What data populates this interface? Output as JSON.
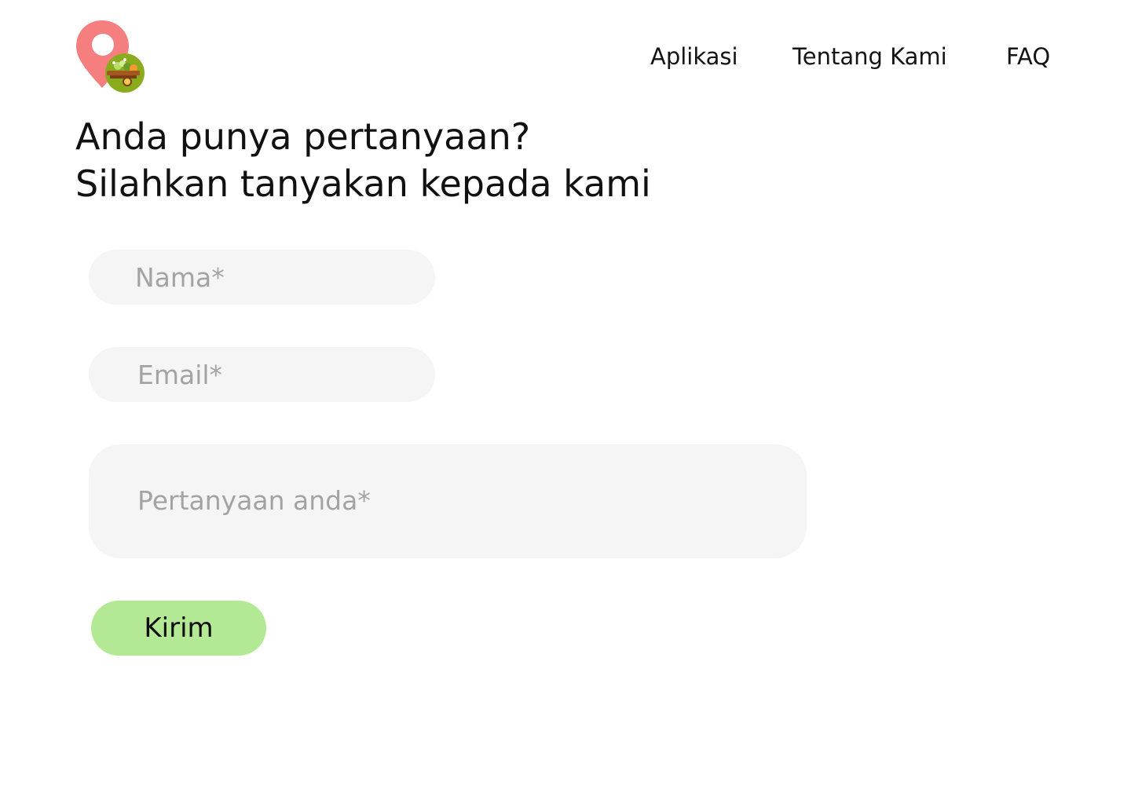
{
  "header": {
    "logo_icon": "map-pin-with-food-cart-icon",
    "brand_colors": {
      "pin": "#f47f7e",
      "badge": "#8aac1c",
      "cart": "#a3581f"
    },
    "nav": {
      "apps_label": "Aplikasi",
      "about_label": "Tentang Kami",
      "faq_label": "FAQ"
    }
  },
  "main": {
    "heading_line1": "Anda punya pertanyaan?",
    "heading_line2": "Silahkan tanyakan kepada kami",
    "form": {
      "name_placeholder": "Nama*",
      "email_placeholder": "Email*",
      "question_placeholder": "Pertanyaan anda*",
      "submit_label": "Kirim"
    }
  },
  "colors": {
    "input_bg": "#f5f5f5",
    "placeholder": "#a3a3a3",
    "button_bg": "#b3e994",
    "text": "#111111"
  }
}
